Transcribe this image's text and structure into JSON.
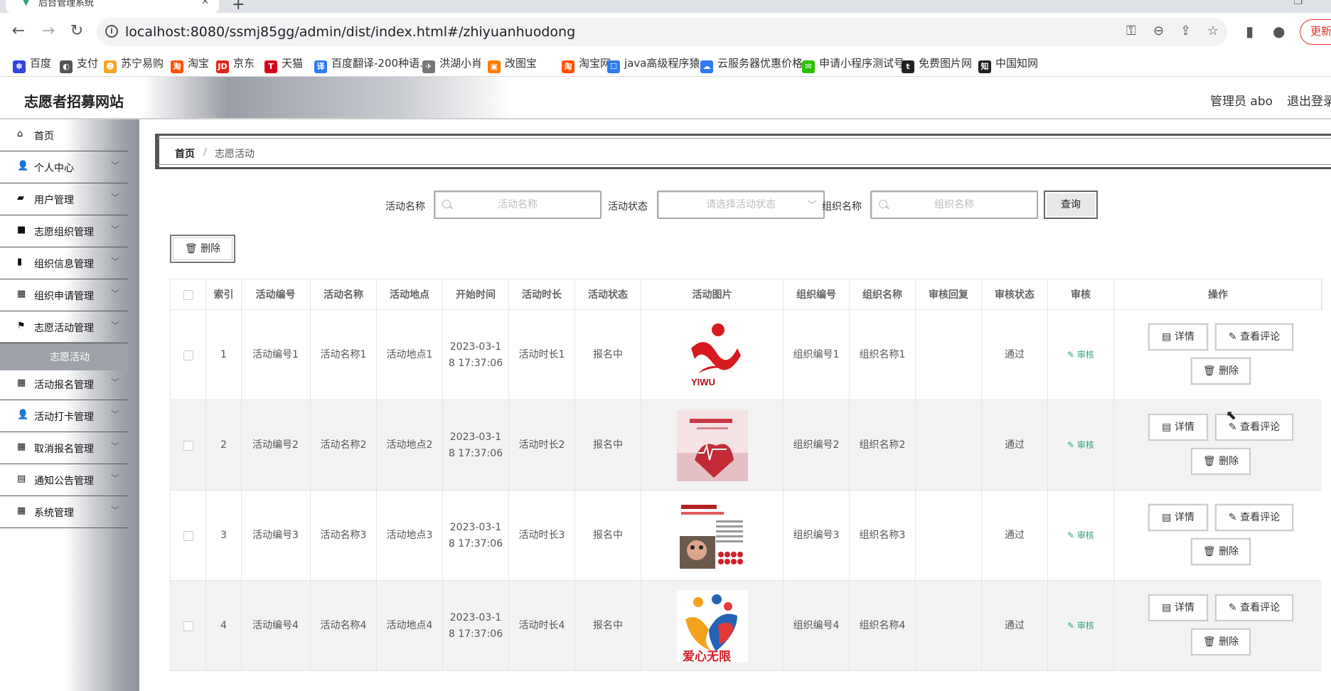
{
  "browser": {
    "tab_title": "后台管理系统",
    "url": "localhost:8080/ssmj85gg/admin/dist/index.html#/zhiyuanhuodong",
    "update_label": "更新",
    "bookmarks": [
      {
        "label": "百度",
        "icon": "paw-icon",
        "color": "#3245df"
      },
      {
        "label": "支付",
        "icon": "globe-icon",
        "color": "#555555"
      },
      {
        "label": "苏宁易购",
        "icon": "lion-icon",
        "color": "#f5a623"
      },
      {
        "label": "淘宝",
        "icon": "taobao-icon",
        "color": "#ff5000"
      },
      {
        "label": "京东",
        "icon": "jd-icon",
        "color": "#e1251b"
      },
      {
        "label": "天猫",
        "icon": "tmall-icon",
        "color": "#d9001b"
      },
      {
        "label": "百度翻译-200种语...",
        "icon": "translate-icon",
        "color": "#2f7bf0"
      },
      {
        "label": "洪湖小肖",
        "icon": "bird-icon",
        "color": "#777777"
      },
      {
        "label": "改图宝",
        "icon": "image-icon",
        "color": "#ff7a00"
      },
      {
        "label": "淘宝网",
        "icon": "taobao-icon",
        "color": "#ff5000"
      },
      {
        "label": "java高级程序猿",
        "icon": "robot-icon",
        "color": "#2f7bf0"
      },
      {
        "label": "云服务器优惠价格",
        "icon": "cloud-icon",
        "color": "#2f7bf0"
      },
      {
        "label": "申请小程序测试号",
        "icon": "wechat-icon",
        "color": "#2dc100"
      },
      {
        "label": "免费图片网",
        "icon": "t-icon",
        "color": "#222222"
      },
      {
        "label": "中国知网",
        "icon": "cnki-icon",
        "color": "#222222"
      }
    ]
  },
  "header": {
    "site_title": "志愿者招募网站",
    "admin_user": "管理员 abo",
    "logout": "退出登录"
  },
  "sidebar": {
    "items": [
      {
        "label": "首页",
        "icon": "home-icon"
      },
      {
        "label": "个人中心",
        "icon": "user-icon"
      },
      {
        "label": "用户管理",
        "icon": "user-admin-icon"
      },
      {
        "label": "志愿组织管理",
        "icon": "video-icon"
      },
      {
        "label": "组织信息管理",
        "icon": "bar-chart-icon"
      },
      {
        "label": "组织申请管理",
        "icon": "grid-icon"
      },
      {
        "label": "志愿活动管理",
        "icon": "flag-icon"
      },
      {
        "label": "活动报名管理",
        "icon": "grid-icon"
      },
      {
        "label": "活动打卡管理",
        "icon": "user-icon"
      },
      {
        "label": "取消报名管理",
        "icon": "grid-icon"
      },
      {
        "label": "通知公告管理",
        "icon": "clipboard-icon"
      },
      {
        "label": "系统管理",
        "icon": "grid-icon"
      }
    ],
    "active_sub": "志愿活动"
  },
  "breadcrumb": {
    "home": "首页",
    "separator": "/",
    "current": "志愿活动"
  },
  "filters": {
    "name_label": "活动名称",
    "name_placeholder": "活动名称",
    "status_label": "活动状态",
    "status_placeholder": "请选择活动状态",
    "org_label": "组织名称",
    "org_placeholder": "组织名称",
    "query_label": "查询"
  },
  "toolbar": {
    "delete_label": "删除"
  },
  "table": {
    "headers": [
      "索引",
      "活动编号",
      "活动名称",
      "活动地点",
      "开始时间",
      "活动时长",
      "活动状态",
      "活动图片",
      "组织编号",
      "组织名称",
      "审核回复",
      "审核状态",
      "审核",
      "操作"
    ],
    "rows": [
      {
        "index": "1",
        "code": "活动编号1",
        "name": "活动名称1",
        "place": "活动地点1",
        "start_l1": "2023-03-1",
        "start_l2": "8 17:37:06",
        "duration": "活动时长1",
        "status": "报名中",
        "org_code": "组织编号1",
        "org_name": "组织名称1",
        "reply": "",
        "audit_status": "通过",
        "audit": "审核"
      },
      {
        "index": "2",
        "code": "活动编号2",
        "name": "活动名称2",
        "place": "活动地点2",
        "start_l1": "2023-03-1",
        "start_l2": "8 17:37:06",
        "duration": "活动时长2",
        "status": "报名中",
        "org_code": "组织编号2",
        "org_name": "组织名称2",
        "reply": "",
        "audit_status": "通过",
        "audit": "审核"
      },
      {
        "index": "3",
        "code": "活动编号3",
        "name": "活动名称3",
        "place": "活动地点3",
        "start_l1": "2023-03-1",
        "start_l2": "8 17:37:06",
        "duration": "活动时长3",
        "status": "报名中",
        "org_code": "组织编号3",
        "org_name": "组织名称3",
        "reply": "",
        "audit_status": "通过",
        "audit": "审核"
      },
      {
        "index": "4",
        "code": "活动编号4",
        "name": "活动名称4",
        "place": "活动地点4",
        "start_l1": "2023-03-1",
        "start_l2": "8 17:37:06",
        "duration": "活动时长4",
        "status": "报名中",
        "org_code": "组织编号4",
        "org_name": "组织名称4",
        "reply": "",
        "audit_status": "通过",
        "audit": "审核"
      }
    ],
    "detail_label": "详情",
    "comments_label": "查看评论",
    "delete_label": "删除"
  },
  "thumb_logo_1_text": "YIWU",
  "thumb_logo_4_text": "爱心无限"
}
